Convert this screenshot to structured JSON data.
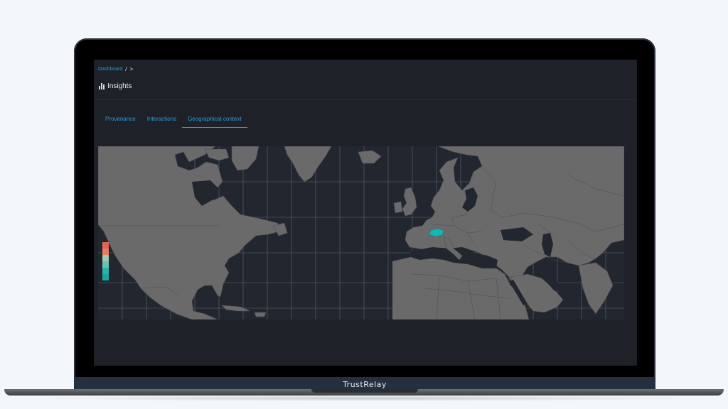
{
  "breadcrumb": {
    "root_label": "Dashboard",
    "separator": "/",
    "chevron": ">"
  },
  "page": {
    "title": "Insights",
    "title_icon": "bar-chart-icon"
  },
  "tabs": [
    {
      "label": "Provenance",
      "active": false
    },
    {
      "label": "Interactions",
      "active": false
    },
    {
      "label": "Geographical context",
      "active": true
    }
  ],
  "device": {
    "brand": "TrustRelay"
  },
  "map": {
    "land_color": "#6a6a6a",
    "water_color": "#22262f",
    "grid_color": "#7a7e84",
    "highlight_color": "#14b8b0",
    "highlighted_region": "Switzerland",
    "legend_colors": [
      "#e4644f",
      "#e47e64",
      "#9fc9b4",
      "#66c4b1",
      "#2fb0a7",
      "#14a89f"
    ]
  },
  "colors": {
    "accent": "#2b9bd6",
    "screen_bg": "#1e2128",
    "page_bg": "#f4f7fa"
  }
}
